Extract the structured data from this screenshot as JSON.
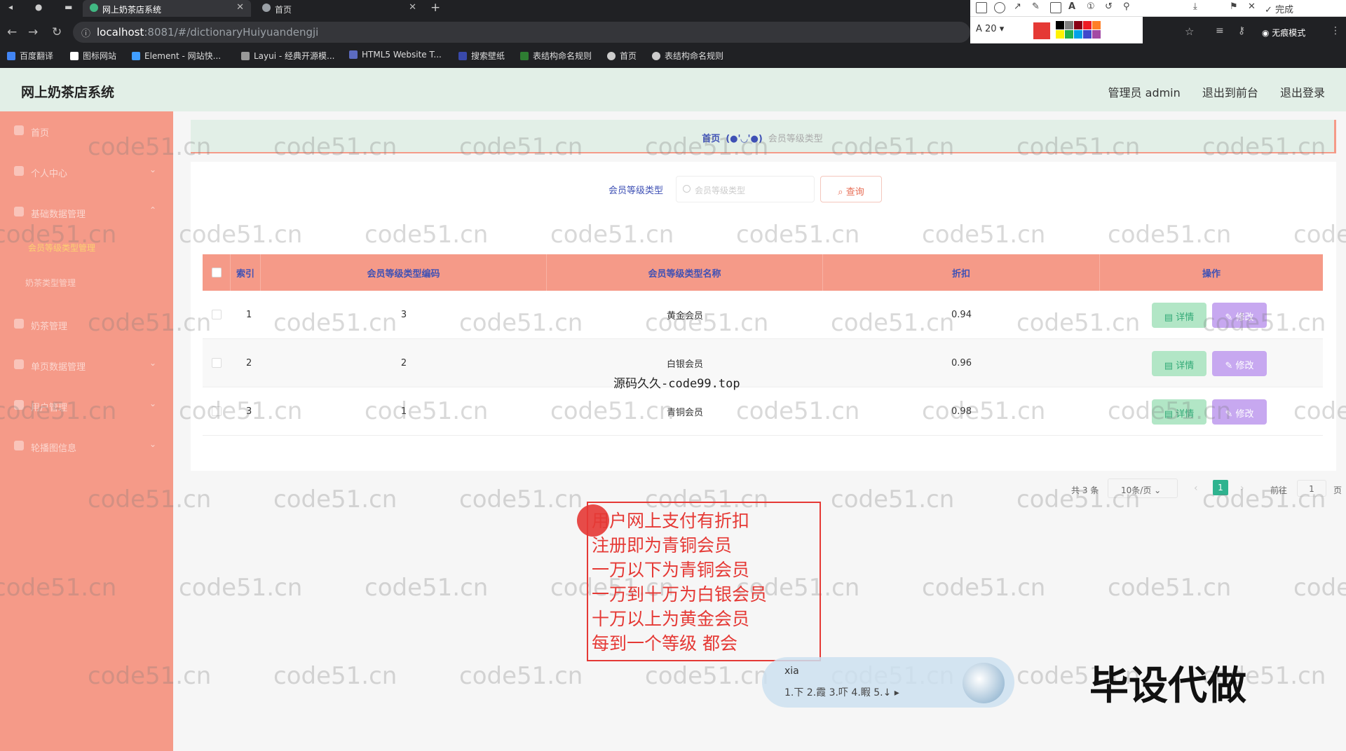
{
  "browser": {
    "tabs": [
      {
        "title": "网上奶茶店系统",
        "active": true
      },
      {
        "title": "首页",
        "active": false
      }
    ],
    "url_host": "localhost",
    "url_path": ":8081/#/dictionaryHuiyuandengji",
    "bookmarks": [
      "百度翻译",
      "图标网站",
      "Element - 网站快...",
      "Layui - 经典开源模...",
      "HTML5 Website T...",
      "搜索壁纸",
      "表结构命名规则",
      "首页",
      "表结构命名规则"
    ],
    "incognito_label": "无痕模式",
    "annot_toolbar": {
      "font_size": "20",
      "done": "完成",
      "colors": [
        "#000000",
        "#7f7f7f",
        "#880015",
        "#ed1c24",
        "#ff7f27",
        "#fff200",
        "#22b14c",
        "#00a2e8",
        "#3f48cc",
        "#a349a4"
      ]
    }
  },
  "app": {
    "title": "网上奶茶店系统",
    "header_links": [
      "管理员 admin",
      "退出到前台",
      "退出登录"
    ]
  },
  "sidebar": {
    "items": [
      {
        "label": "首页",
        "icon": "home-icon"
      },
      {
        "label": "个人中心",
        "icon": "user-icon"
      },
      {
        "label": "基础数据管理",
        "icon": "data-icon"
      },
      {
        "label": "奶茶管理",
        "icon": "tea-icon"
      },
      {
        "label": "单页数据管理",
        "icon": "page-icon"
      },
      {
        "label": "用户管理",
        "icon": "users-icon"
      },
      {
        "label": "轮播图信息",
        "icon": "image-icon"
      }
    ],
    "subitems": [
      "会员等级类型管理",
      "奶茶类型管理"
    ]
  },
  "breadcrumb": {
    "home": "首页",
    "sep": "(●'◡'●)",
    "current": "会员等级类型"
  },
  "search": {
    "label": "会员等级类型",
    "placeholder": "会员等级类型",
    "button": "查询"
  },
  "table": {
    "headers": [
      "索引",
      "会员等级类型编码",
      "会员等级类型名称",
      "折扣",
      "操作"
    ],
    "rows": [
      {
        "index": "1",
        "code": "3",
        "name": "黄金会员",
        "discount": "0.94"
      },
      {
        "index": "2",
        "code": "2",
        "name": "白银会员",
        "discount": "0.96"
      },
      {
        "index": "3",
        "code": "1",
        "name": "青铜会员",
        "discount": "0.98"
      }
    ],
    "detail_label": "详情",
    "edit_label": "修改"
  },
  "pager": {
    "total": "共 3 条",
    "page_size": "10条/页",
    "current": "1",
    "goto": "前往",
    "goto_value": "1",
    "page_unit": "页"
  },
  "overlays": {
    "watermark": "code51.cn",
    "source_text": "源码久久-code99.top",
    "note_lines": [
      "用户网上支付有折扣",
      "注册即为青铜会员",
      "一万以下为青铜会员",
      "一万到十万为白银会员",
      "十万以上为黄金会员",
      "每到一个等级  都会"
    ],
    "ime_composition": "xia",
    "ime_candidates": "1.下  2.霞  3.吓  4.睱  5.↓",
    "banner": "毕设代做"
  }
}
